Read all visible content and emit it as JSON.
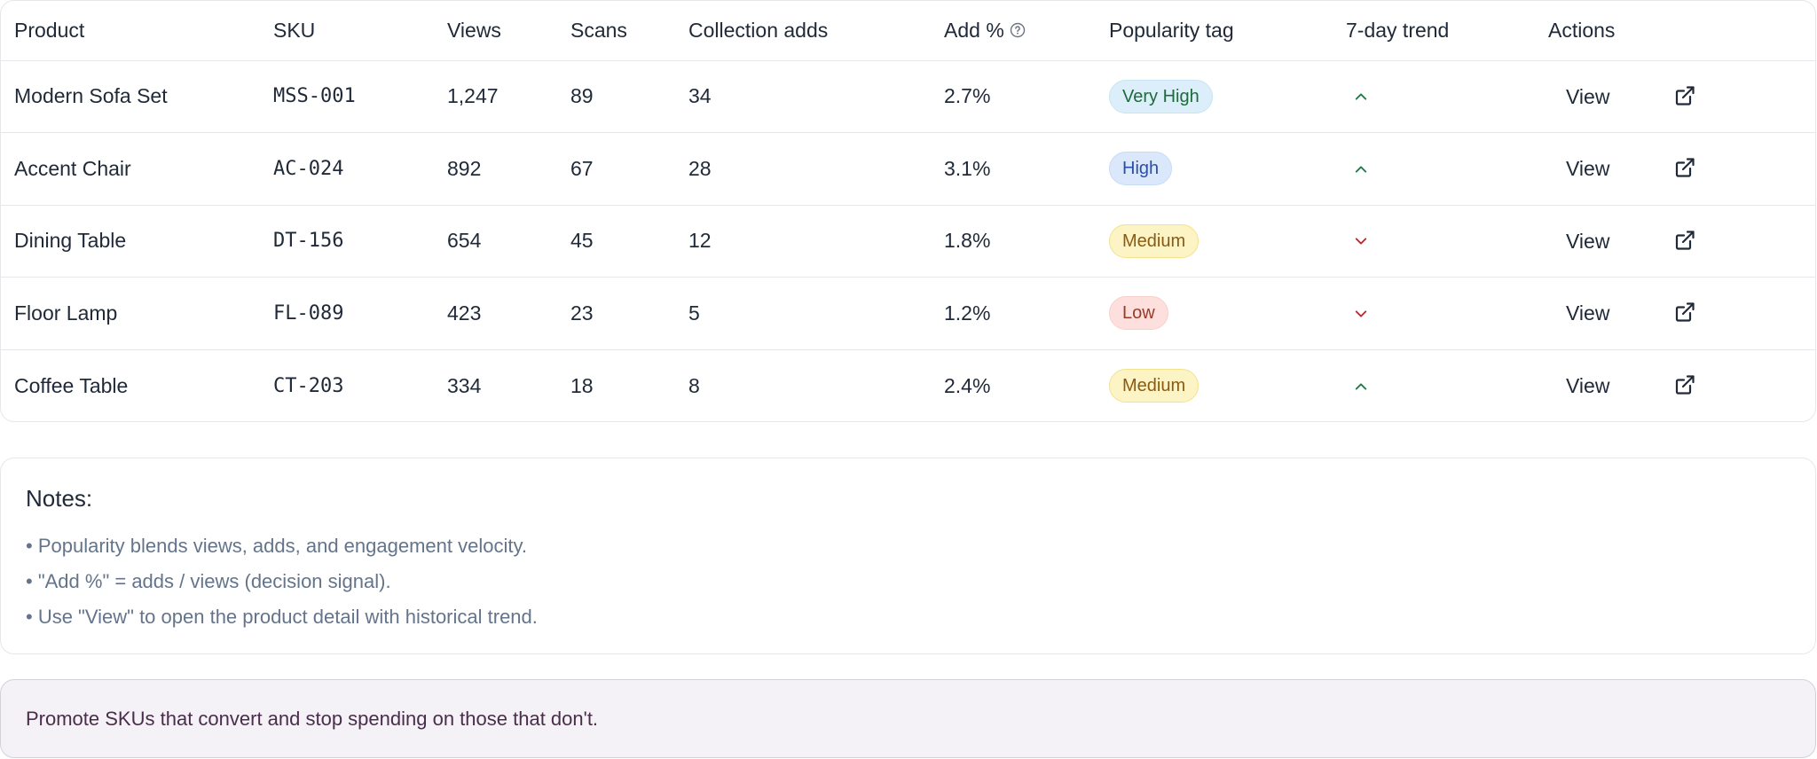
{
  "table": {
    "headers": {
      "product": "Product",
      "sku": "SKU",
      "views": "Views",
      "scans": "Scans",
      "collection_adds": "Collection adds",
      "add_pct": "Add %",
      "popularity_tag": "Popularity tag",
      "trend": "7-day trend",
      "actions": "Actions"
    },
    "rows": [
      {
        "product": "Modern Sofa Set",
        "sku": "MSS-001",
        "views": "1,247",
        "scans": "89",
        "adds": "34",
        "add_pct": "2.7%",
        "tag": "Very High",
        "tag_style": "veryhigh",
        "trend": "up",
        "view": "View"
      },
      {
        "product": "Accent Chair",
        "sku": "AC-024",
        "views": "892",
        "scans": "67",
        "adds": "28",
        "add_pct": "3.1%",
        "tag": "High",
        "tag_style": "high",
        "trend": "up",
        "view": "View"
      },
      {
        "product": "Dining Table",
        "sku": "DT-156",
        "views": "654",
        "scans": "45",
        "adds": "12",
        "add_pct": "1.8%",
        "tag": "Medium",
        "tag_style": "medium",
        "trend": "down",
        "view": "View"
      },
      {
        "product": "Floor Lamp",
        "sku": "FL-089",
        "views": "423",
        "scans": "23",
        "adds": "5",
        "add_pct": "1.2%",
        "tag": "Low",
        "tag_style": "low",
        "trend": "down",
        "view": "View"
      },
      {
        "product": "Coffee Table",
        "sku": "CT-203",
        "views": "334",
        "scans": "18",
        "adds": "8",
        "add_pct": "2.4%",
        "tag": "Medium",
        "tag_style": "medium",
        "trend": "up",
        "view": "View"
      }
    ]
  },
  "notes": {
    "title": "Notes:",
    "items": [
      "• Popularity blends views, adds, and engagement velocity.",
      "• \"Add %\" = adds / views (decision signal).",
      "• Use \"View\" to open the product detail with historical trend."
    ]
  },
  "banner": {
    "text": "Promote SKUs that convert and stop spending on those that don't."
  },
  "colors": {
    "trend_up": "#1e7a45",
    "trend_down": "#c0262d",
    "icon": "#1f2937"
  },
  "icons": {
    "help": "question-circle-icon",
    "trend_up": "chevron-up-icon",
    "trend_down": "chevron-down-icon",
    "external": "external-link-icon"
  }
}
